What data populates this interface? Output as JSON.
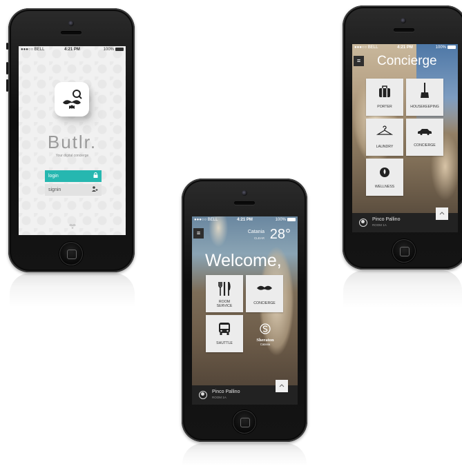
{
  "status": {
    "carrier": "●●●○○ BELL",
    "time": "4:21 PM",
    "battery": "100%"
  },
  "login_screen": {
    "app_name": "Butlr.",
    "tagline": "Your digital concierge",
    "login_label": "login",
    "signin_label": "signin"
  },
  "home_screen": {
    "city": "Catania",
    "condition": "CLEAR",
    "temperature": "28°",
    "welcome": "Welcome,",
    "tiles": [
      {
        "label_line1": "ROOM",
        "label_line2": "SERVICE",
        "icon": "cutlery-icon"
      },
      {
        "label_line1": "CONCIERGE",
        "label_line2": "",
        "icon": "mustache-icon"
      },
      {
        "label_line1": "SHUTTLE",
        "label_line2": "",
        "icon": "bus-icon"
      }
    ],
    "hotel_name": "Sheraton",
    "hotel_sub": "Catania"
  },
  "concierge_screen": {
    "title": "Concierge",
    "tiles": [
      {
        "label": "PORTER",
        "icon": "luggage-icon"
      },
      {
        "label": "HOUSEKEEPING",
        "icon": "broom-icon"
      },
      {
        "label": "LAUNDRY",
        "icon": "hanger-icon"
      },
      {
        "label": "CONCIERGE",
        "icon": "car-icon"
      },
      {
        "label": "WELLNESS",
        "icon": "drop-icon"
      }
    ]
  },
  "user": {
    "name": "Pinco Pallino",
    "room": "ROOM 1A"
  },
  "colors": {
    "accent": "#26b7b0",
    "dark_bar": "#222222",
    "tile_bg": "#ececec"
  }
}
